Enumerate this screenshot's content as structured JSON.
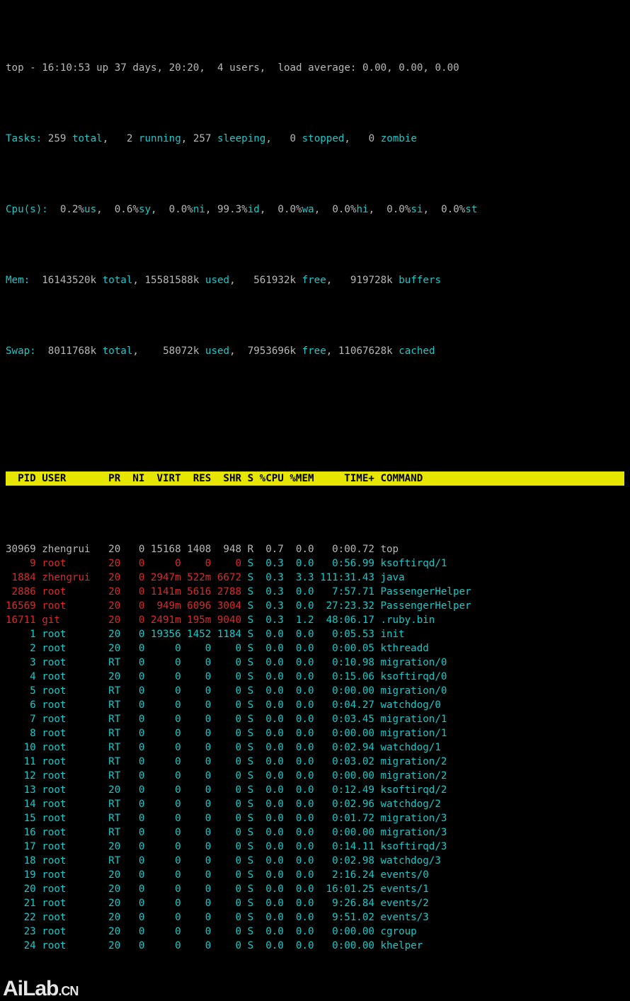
{
  "summary": {
    "line1_pre": "top - ",
    "time": "16:10:53",
    "up_label": " up ",
    "uptime": "37 days, 20:20",
    "users_sep": ",  ",
    "users": "4 users",
    "load_sep": ",  ",
    "load_label": "load average: ",
    "load": "0.00, 0.00, 0.00",
    "tasks_label": "Tasks:",
    "tasks_total_n": " 259 ",
    "tasks_total_l": "total",
    "tasks_sep1": ",   ",
    "tasks_run_n": "2 ",
    "tasks_run_l": "running",
    "tasks_sep2": ", ",
    "tasks_sleep_n": "257 ",
    "tasks_sleep_l": "sleeping",
    "tasks_sep3": ",   ",
    "tasks_stop_n": "0 ",
    "tasks_stop_l": "stopped",
    "tasks_sep4": ",   ",
    "tasks_zomb_n": "0 ",
    "tasks_zomb_l": "zombie",
    "cpu_label": "Cpu(s):",
    "cpu_us_n": "  0.2%",
    "cpu_us_l": "us",
    "cpu_sy_n": ",  0.6%",
    "cpu_sy_l": "sy",
    "cpu_ni_n": ",  0.0%",
    "cpu_ni_l": "ni",
    "cpu_id_n": ", 99.3%",
    "cpu_id_l": "id",
    "cpu_wa_n": ",  0.0%",
    "cpu_wa_l": "wa",
    "cpu_hi_n": ",  0.0%",
    "cpu_hi_l": "hi",
    "cpu_si_n": ",  0.0%",
    "cpu_si_l": "si",
    "cpu_st_n": ",  0.0%",
    "cpu_st_l": "st",
    "mem_label": "Mem: ",
    "mem_total_n": " 16143520k ",
    "mem_total_l": "total",
    "mem_used_n": ", 15581588k ",
    "mem_used_l": "used",
    "mem_free_n": ",   561932k ",
    "mem_free_l": "free",
    "mem_buf_n": ",   919728k ",
    "mem_buf_l": "buffers",
    "swap_label": "Swap:",
    "swap_total_n": "  8011768k ",
    "swap_total_l": "total",
    "swap_used_n": ",    58072k ",
    "swap_used_l": "used",
    "swap_free_n": ",  7953696k ",
    "swap_free_l": "free",
    "swap_cache_n": ", 11067628k ",
    "swap_cache_l": "cached"
  },
  "columns": {
    "pid": "PID",
    "user": "USER",
    "pr": "PR",
    "ni": "NI",
    "virt": "VIRT",
    "res": "RES",
    "shr": "SHR",
    "s": "S",
    "cpu": "%CPU",
    "mem": "%MEM",
    "time": "TIME+",
    "cmd": "COMMAND"
  },
  "procs": [
    {
      "kind": "first",
      "pid": "30969",
      "user": "zhengrui",
      "pr": "20",
      "ni": "0",
      "virt": "15168",
      "res": "1408",
      "shr": "948",
      "s": "R",
      "cpu": "0.7",
      "mem": "0.0",
      "time": "0:00.72",
      "cmd": "top"
    },
    {
      "kind": "hl",
      "pid": "9",
      "user": "root",
      "pr": "20",
      "ni": "0",
      "virt": "0",
      "res": "0",
      "shr": "0",
      "s": "S",
      "cpu": "0.3",
      "mem": "0.0",
      "time": "0:56.99",
      "cmd": "ksoftirqd/1"
    },
    {
      "kind": "hl",
      "pid": "1884",
      "user": "zhengrui",
      "pr": "20",
      "ni": "0",
      "virt": "2947m",
      "res": "522m",
      "shr": "6672",
      "s": "S",
      "cpu": "0.3",
      "mem": "3.3",
      "time": "111:31.43",
      "cmd": "java"
    },
    {
      "kind": "hl",
      "pid": "2886",
      "user": "root",
      "pr": "20",
      "ni": "0",
      "virt": "1141m",
      "res": "5616",
      "shr": "2788",
      "s": "S",
      "cpu": "0.3",
      "mem": "0.0",
      "time": "7:57.71",
      "cmd": "PassengerHelper"
    },
    {
      "kind": "hl",
      "pid": "16569",
      "user": "root",
      "pr": "20",
      "ni": "0",
      "virt": "949m",
      "res": "6096",
      "shr": "3004",
      "s": "S",
      "cpu": "0.3",
      "mem": "0.0",
      "time": "27:23.32",
      "cmd": "PassengerHelper"
    },
    {
      "kind": "hl",
      "pid": "16711",
      "user": "git",
      "pr": "20",
      "ni": "0",
      "virt": "2491m",
      "res": "195m",
      "shr": "9040",
      "s": "S",
      "cpu": "0.3",
      "mem": "1.2",
      "time": "48:06.17",
      "cmd": ".ruby.bin"
    },
    {
      "kind": "norm",
      "pid": "1",
      "user": "root",
      "pr": "20",
      "ni": "0",
      "virt": "19356",
      "res": "1452",
      "shr": "1184",
      "s": "S",
      "cpu": "0.0",
      "mem": "0.0",
      "time": "0:05.53",
      "cmd": "init"
    },
    {
      "kind": "norm",
      "pid": "2",
      "user": "root",
      "pr": "20",
      "ni": "0",
      "virt": "0",
      "res": "0",
      "shr": "0",
      "s": "S",
      "cpu": "0.0",
      "mem": "0.0",
      "time": "0:00.05",
      "cmd": "kthreadd"
    },
    {
      "kind": "norm",
      "pid": "3",
      "user": "root",
      "pr": "RT",
      "ni": "0",
      "virt": "0",
      "res": "0",
      "shr": "0",
      "s": "S",
      "cpu": "0.0",
      "mem": "0.0",
      "time": "0:10.98",
      "cmd": "migration/0"
    },
    {
      "kind": "norm",
      "pid": "4",
      "user": "root",
      "pr": "20",
      "ni": "0",
      "virt": "0",
      "res": "0",
      "shr": "0",
      "s": "S",
      "cpu": "0.0",
      "mem": "0.0",
      "time": "0:15.06",
      "cmd": "ksoftirqd/0"
    },
    {
      "kind": "norm",
      "pid": "5",
      "user": "root",
      "pr": "RT",
      "ni": "0",
      "virt": "0",
      "res": "0",
      "shr": "0",
      "s": "S",
      "cpu": "0.0",
      "mem": "0.0",
      "time": "0:00.00",
      "cmd": "migration/0"
    },
    {
      "kind": "norm",
      "pid": "6",
      "user": "root",
      "pr": "RT",
      "ni": "0",
      "virt": "0",
      "res": "0",
      "shr": "0",
      "s": "S",
      "cpu": "0.0",
      "mem": "0.0",
      "time": "0:04.27",
      "cmd": "watchdog/0"
    },
    {
      "kind": "norm",
      "pid": "7",
      "user": "root",
      "pr": "RT",
      "ni": "0",
      "virt": "0",
      "res": "0",
      "shr": "0",
      "s": "S",
      "cpu": "0.0",
      "mem": "0.0",
      "time": "0:03.45",
      "cmd": "migration/1"
    },
    {
      "kind": "norm",
      "pid": "8",
      "user": "root",
      "pr": "RT",
      "ni": "0",
      "virt": "0",
      "res": "0",
      "shr": "0",
      "s": "S",
      "cpu": "0.0",
      "mem": "0.0",
      "time": "0:00.00",
      "cmd": "migration/1"
    },
    {
      "kind": "norm",
      "pid": "10",
      "user": "root",
      "pr": "RT",
      "ni": "0",
      "virt": "0",
      "res": "0",
      "shr": "0",
      "s": "S",
      "cpu": "0.0",
      "mem": "0.0",
      "time": "0:02.94",
      "cmd": "watchdog/1"
    },
    {
      "kind": "norm",
      "pid": "11",
      "user": "root",
      "pr": "RT",
      "ni": "0",
      "virt": "0",
      "res": "0",
      "shr": "0",
      "s": "S",
      "cpu": "0.0",
      "mem": "0.0",
      "time": "0:03.02",
      "cmd": "migration/2"
    },
    {
      "kind": "norm",
      "pid": "12",
      "user": "root",
      "pr": "RT",
      "ni": "0",
      "virt": "0",
      "res": "0",
      "shr": "0",
      "s": "S",
      "cpu": "0.0",
      "mem": "0.0",
      "time": "0:00.00",
      "cmd": "migration/2"
    },
    {
      "kind": "norm",
      "pid": "13",
      "user": "root",
      "pr": "20",
      "ni": "0",
      "virt": "0",
      "res": "0",
      "shr": "0",
      "s": "S",
      "cpu": "0.0",
      "mem": "0.0",
      "time": "0:12.49",
      "cmd": "ksoftirqd/2"
    },
    {
      "kind": "norm",
      "pid": "14",
      "user": "root",
      "pr": "RT",
      "ni": "0",
      "virt": "0",
      "res": "0",
      "shr": "0",
      "s": "S",
      "cpu": "0.0",
      "mem": "0.0",
      "time": "0:02.96",
      "cmd": "watchdog/2"
    },
    {
      "kind": "norm",
      "pid": "15",
      "user": "root",
      "pr": "RT",
      "ni": "0",
      "virt": "0",
      "res": "0",
      "shr": "0",
      "s": "S",
      "cpu": "0.0",
      "mem": "0.0",
      "time": "0:01.72",
      "cmd": "migration/3"
    },
    {
      "kind": "norm",
      "pid": "16",
      "user": "root",
      "pr": "RT",
      "ni": "0",
      "virt": "0",
      "res": "0",
      "shr": "0",
      "s": "S",
      "cpu": "0.0",
      "mem": "0.0",
      "time": "0:00.00",
      "cmd": "migration/3"
    },
    {
      "kind": "norm",
      "pid": "17",
      "user": "root",
      "pr": "20",
      "ni": "0",
      "virt": "0",
      "res": "0",
      "shr": "0",
      "s": "S",
      "cpu": "0.0",
      "mem": "0.0",
      "time": "0:14.11",
      "cmd": "ksoftirqd/3"
    },
    {
      "kind": "norm",
      "pid": "18",
      "user": "root",
      "pr": "RT",
      "ni": "0",
      "virt": "0",
      "res": "0",
      "shr": "0",
      "s": "S",
      "cpu": "0.0",
      "mem": "0.0",
      "time": "0:02.98",
      "cmd": "watchdog/3"
    },
    {
      "kind": "norm",
      "pid": "19",
      "user": "root",
      "pr": "20",
      "ni": "0",
      "virt": "0",
      "res": "0",
      "shr": "0",
      "s": "S",
      "cpu": "0.0",
      "mem": "0.0",
      "time": "2:16.24",
      "cmd": "events/0"
    },
    {
      "kind": "norm",
      "pid": "20",
      "user": "root",
      "pr": "20",
      "ni": "0",
      "virt": "0",
      "res": "0",
      "shr": "0",
      "s": "S",
      "cpu": "0.0",
      "mem": "0.0",
      "time": "16:01.25",
      "cmd": "events/1"
    },
    {
      "kind": "norm",
      "pid": "21",
      "user": "root",
      "pr": "20",
      "ni": "0",
      "virt": "0",
      "res": "0",
      "shr": "0",
      "s": "S",
      "cpu": "0.0",
      "mem": "0.0",
      "time": "9:26.84",
      "cmd": "events/2"
    },
    {
      "kind": "norm",
      "pid": "22",
      "user": "root",
      "pr": "20",
      "ni": "0",
      "virt": "0",
      "res": "0",
      "shr": "0",
      "s": "S",
      "cpu": "0.0",
      "mem": "0.0",
      "time": "9:51.02",
      "cmd": "events/3"
    },
    {
      "kind": "norm",
      "pid": "23",
      "user": "root",
      "pr": "20",
      "ni": "0",
      "virt": "0",
      "res": "0",
      "shr": "0",
      "s": "S",
      "cpu": "0.0",
      "mem": "0.0",
      "time": "0:00.00",
      "cmd": "cgroup"
    },
    {
      "kind": "norm",
      "pid": "24",
      "user": "root",
      "pr": "20",
      "ni": "0",
      "virt": "0",
      "res": "0",
      "shr": "0",
      "s": "S",
      "cpu": "0.0",
      "mem": "0.0",
      "time": "0:00.00",
      "cmd": "khelper"
    }
  ],
  "watermark": {
    "brand": "AiLab",
    "suffix": ".CN"
  }
}
